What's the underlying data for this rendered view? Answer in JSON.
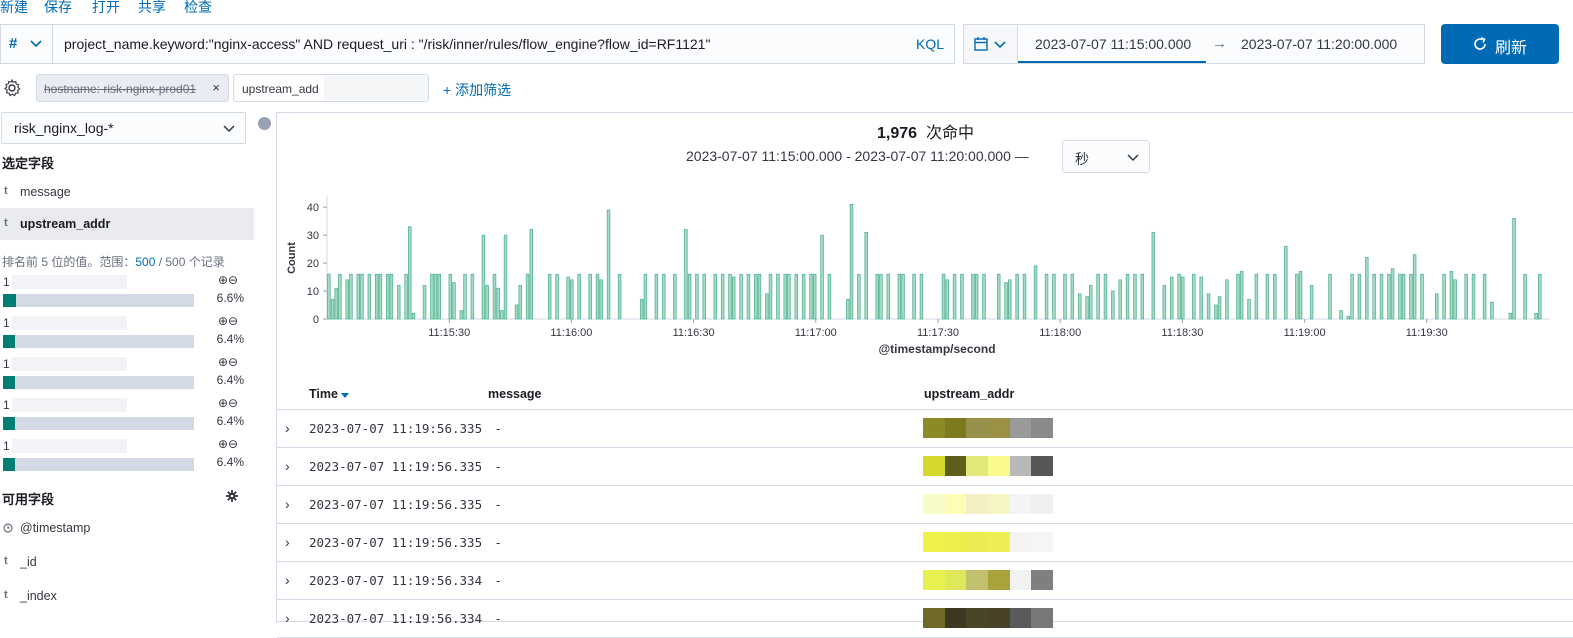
{
  "top_menu": [
    "新建",
    "保存",
    "打开",
    "共享",
    "检查"
  ],
  "query": {
    "language_symbol": "#",
    "text": "project_name.keyword:\"nginx-access\" AND request_uri : \"/risk/inner/rules/flow_engine?flow_id=RF1121\"",
    "language_label": "KQL"
  },
  "time_range": {
    "start": "2023-07-07 11:15:00.000",
    "arrow": "→",
    "end": "2023-07-07 11:20:00.000"
  },
  "refresh_label": "刷新",
  "filters": [
    {
      "label": "hostname: risk-nginx-prod01",
      "disabled": true,
      "remove": "×"
    },
    {
      "label": "upstream_add",
      "disabled": false
    }
  ],
  "add_filter_label": "+ 添加筛选",
  "sidebar": {
    "index_pattern": "risk_nginx_log-*",
    "selected_title": "选定字段",
    "selected_fields": [
      {
        "type": "t",
        "name": "message"
      },
      {
        "type": "t",
        "name": "upstream_addr"
      }
    ],
    "top_values": {
      "prefix": "排名前 5 位的值。范围：",
      "count": "500",
      "suffix": " / 500 个记录"
    },
    "values": [
      {
        "label": "1",
        "pct": "6.6%",
        "fraction": 0.066
      },
      {
        "label": "1",
        "pct": "6.4%",
        "fraction": 0.064
      },
      {
        "label": "1",
        "pct": "6.4%",
        "fraction": 0.064
      },
      {
        "label": "1",
        "pct": "6.4%",
        "fraction": 0.064
      },
      {
        "label": "1",
        "pct": "6.4%",
        "fraction": 0.064
      }
    ],
    "available_title": "可用字段",
    "available_fields": [
      {
        "type": "clock",
        "name": "@timestamp"
      },
      {
        "type": "t",
        "name": "_id"
      },
      {
        "type": "t",
        "name": "_index"
      }
    ]
  },
  "hits": {
    "count": "1,976",
    "label": "次命中"
  },
  "range_text": "2023-07-07 11:15:00.000 - 2023-07-07 11:20:00.000 —",
  "interval": "秒",
  "chart_data": {
    "type": "bar",
    "xlabel": "@timestamp/second",
    "ylabel": "Count",
    "ylim": [
      0,
      44
    ],
    "yticks": [
      0,
      10,
      20,
      30,
      40
    ],
    "x_range_seconds": [
      0,
      300
    ],
    "xticks": [
      {
        "t": 30,
        "label": "11:15:30"
      },
      {
        "t": 60,
        "label": "11:16:00"
      },
      {
        "t": 90,
        "label": "11:16:30"
      },
      {
        "t": 120,
        "label": "11:17:00"
      },
      {
        "t": 150,
        "label": "11:17:30"
      },
      {
        "t": 180,
        "label": "11:18:00"
      },
      {
        "t": 210,
        "label": "11:18:30"
      },
      {
        "t": 240,
        "label": "11:19:00"
      },
      {
        "t": 270,
        "label": "11:19:30"
      }
    ],
    "color": "#54b399",
    "values": [
      16,
      7,
      11,
      16,
      0,
      14,
      16,
      0,
      16,
      16,
      0,
      16,
      0,
      16,
      16,
      0,
      16,
      16,
      0,
      12,
      0,
      16,
      33,
      2,
      0,
      0,
      12,
      0,
      16,
      16,
      16,
      0,
      0,
      16,
      13,
      0,
      3,
      16,
      0,
      16,
      0,
      0,
      30,
      12,
      0,
      16,
      11,
      3,
      30,
      0,
      0,
      5,
      12,
      0,
      16,
      32,
      0,
      0,
      0,
      0,
      16,
      0,
      16,
      0,
      0,
      15,
      14,
      0,
      16,
      0,
      0,
      16,
      0,
      16,
      14,
      0,
      39,
      0,
      0,
      16,
      0,
      0,
      0,
      0,
      0,
      7,
      16,
      0,
      0,
      16,
      0,
      16,
      0,
      0,
      16,
      0,
      0,
      32,
      16,
      0,
      16,
      0,
      16,
      0,
      0,
      16,
      0,
      16,
      0,
      16,
      15,
      0,
      16,
      0,
      16,
      0,
      16,
      16,
      0,
      9,
      16,
      0,
      16,
      0,
      16,
      16,
      0,
      16,
      0,
      16,
      0,
      16,
      16,
      0,
      30,
      0,
      16,
      0,
      0,
      0,
      0,
      7,
      41,
      0,
      16,
      0,
      31,
      0,
      0,
      16,
      16,
      0,
      16,
      0,
      0,
      16,
      16,
      0,
      0,
      16,
      0,
      16,
      0,
      0,
      0,
      0,
      0,
      16,
      14,
      0,
      16,
      0,
      16,
      0,
      0,
      16,
      16,
      0,
      16,
      0,
      0,
      0,
      16,
      0,
      13,
      14,
      0,
      16,
      0,
      16,
      0,
      0,
      19,
      0,
      0,
      16,
      0,
      16,
      0,
      0,
      16,
      0,
      16,
      0,
      9,
      0,
      8,
      12,
      0,
      16,
      0,
      16,
      0,
      10,
      0,
      14,
      0,
      16,
      0,
      16,
      0,
      16,
      0,
      0,
      31,
      0,
      0,
      12,
      0,
      15,
      0,
      16,
      15,
      0,
      0,
      16,
      0,
      15,
      0,
      9,
      0,
      5,
      8,
      0,
      14,
      0,
      0,
      16,
      17,
      0,
      7,
      0,
      16,
      0,
      0,
      16,
      0,
      16,
      0,
      0,
      26,
      0,
      0,
      16,
      17,
      0,
      0,
      12,
      0,
      0,
      0,
      0,
      16,
      0,
      0,
      3,
      0,
      1,
      16,
      0,
      16,
      0,
      22,
      0,
      16,
      0,
      16,
      0,
      16,
      18,
      0,
      16,
      16,
      0,
      16,
      23,
      0,
      16,
      0,
      0,
      0,
      9,
      0,
      16,
      0,
      17,
      14,
      0,
      0,
      16,
      0,
      16,
      0,
      0,
      16,
      0,
      6,
      0,
      0,
      0,
      0,
      2,
      36,
      0,
      0,
      16,
      0,
      0,
      2,
      16,
      0,
      0
    ]
  },
  "table": {
    "headers": {
      "time": "Time",
      "message": "message",
      "upstream": "upstream_addr"
    },
    "rows": [
      {
        "time": "2023-07-07 11:19:56.335",
        "message": "-",
        "colors": [
          "#8b8a24",
          "#7b7a1e",
          "#97904a",
          "#9a9144",
          "#9a9a9a",
          "#8a8a8a"
        ]
      },
      {
        "time": "2023-07-07 11:19:56.335",
        "message": "-",
        "colors": [
          "#d4d82f",
          "#5f5f19",
          "#e3e77a",
          "#f8fa8c",
          "#b8b8b8",
          "#575757"
        ]
      },
      {
        "time": "2023-07-07 11:19:56.335",
        "message": "-",
        "colors": [
          "#f8fac8",
          "#fdfdb8",
          "#f3f0c2",
          "#f6f6c4",
          "#f4f4f4",
          "#f0f0f0"
        ]
      },
      {
        "time": "2023-07-07 11:19:56.335",
        "message": "-",
        "colors": [
          "#eef04c",
          "#ecee4e",
          "#eaec52",
          "#ecee54",
          "#f3f3f3",
          "#f5f5f5"
        ]
      },
      {
        "time": "2023-07-07 11:19:56.334",
        "message": "-",
        "colors": [
          "#e6f050",
          "#dfe85a",
          "#c1c06c",
          "#a9a33c",
          "#f2f2f2",
          "#7f7f7f"
        ]
      },
      {
        "time": "2023-07-07 11:19:56.334",
        "message": "-",
        "colors": [
          "#6f6a28",
          "#3d3820",
          "#4b4528",
          "#4a4228",
          "#5a5a5a",
          "#787878"
        ]
      }
    ]
  }
}
